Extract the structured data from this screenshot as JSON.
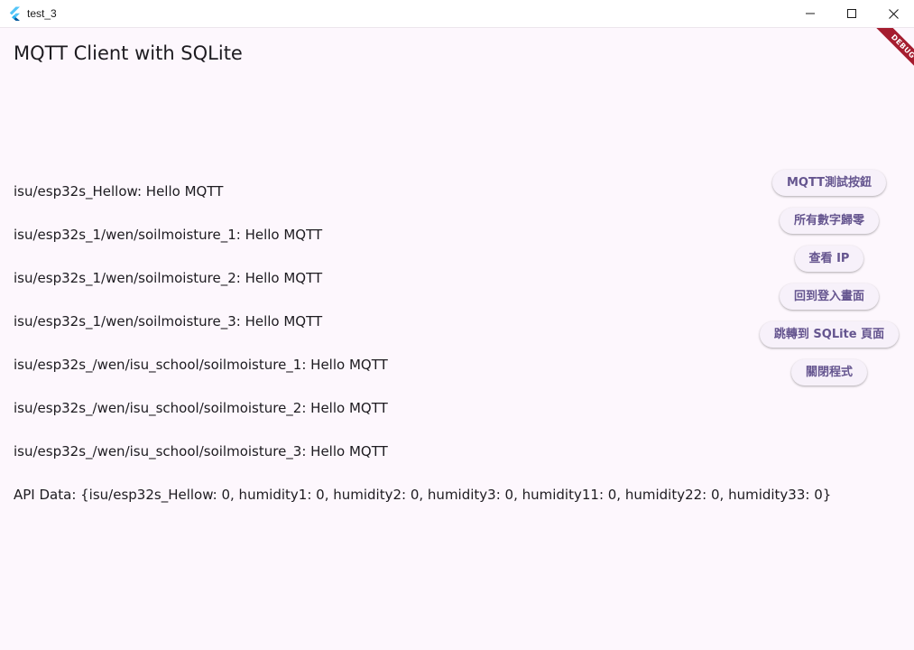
{
  "window": {
    "title": "test_3"
  },
  "debug_banner": {
    "label": "DEBUG",
    "color": "#a51d2f"
  },
  "app": {
    "title": "MQTT Client with SQLite"
  },
  "messages": [
    "isu/esp32s_Hellow: Hello MQTT",
    "isu/esp32s_1/wen/soilmoisture_1: Hello MQTT",
    "isu/esp32s_1/wen/soilmoisture_2: Hello MQTT",
    "isu/esp32s_1/wen/soilmoisture_3: Hello MQTT",
    "isu/esp32s_/wen/isu_school/soilmoisture_1: Hello MQTT",
    "isu/esp32s_/wen/isu_school/soilmoisture_2: Hello MQTT",
    "isu/esp32s_/wen/isu_school/soilmoisture_3: Hello MQTT",
    "API Data: {isu/esp32s_Hellow: 0, humidity1: 0, humidity2: 0, humidity3: 0, humidity11: 0, humidity22: 0, humidity33: 0}"
  ],
  "buttons": {
    "mqtt_test": "MQTT測試按鈕",
    "reset_numbers": "所有數字歸零",
    "view_ip": "查看 IP",
    "back_to_login": "回到登入畫面",
    "go_sqlite": "跳轉到 SQLite 頁面",
    "close_app": "關閉程式"
  },
  "colors": {
    "background": "#fdf7fd",
    "button_text": "#65558f",
    "button_bg": "#f7f1fa",
    "text": "#1d1b20"
  }
}
